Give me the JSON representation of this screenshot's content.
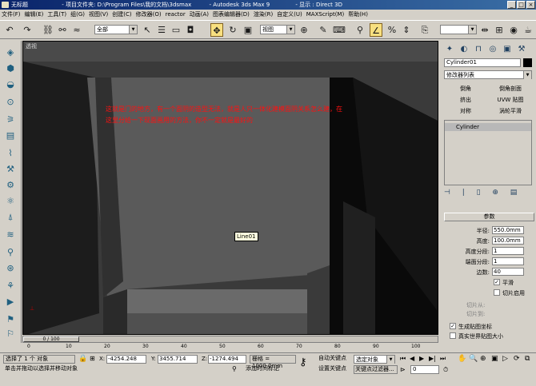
{
  "title": {
    "app": "无标题",
    "project": "- 项目文件夹: D:\\Program Files\\我的文档\\3dsmax",
    "product": "- Autodesk 3ds Max 9",
    "display": "- 显示 : Direct 3D"
  },
  "menu": [
    "文件(F)",
    "编辑(E)",
    "工具(T)",
    "组(G)",
    "视图(V)",
    "创建(C)",
    "修改器(O)",
    "reactor",
    "动画(A)",
    "图表编辑器(D)",
    "渲染(R)",
    "自定义(U)",
    "MAXScript(M)",
    "帮助(H)"
  ],
  "toolbar": {
    "filter": "全部",
    "refcoord": "视图"
  },
  "viewport": {
    "label": "透视",
    "annotation": "这就是门的地方，有一个面阴的造型无法，就是人只一体化建模面阴关系怎么建，在这里分给一下现面画用的方法，你不一定就是最好的",
    "tooltip": "Line01"
  },
  "panel": {
    "object_name": "Cylinder01",
    "modifier_list": "修改器列表",
    "buttons": [
      "倒角",
      "倒角剖面",
      "挤出",
      "UVW 贴图",
      "对称",
      "涡轮平滑"
    ],
    "stack_item": "Cylinder",
    "params_title": "参数",
    "params": [
      {
        "label": "半径:",
        "value": "550.0mm"
      },
      {
        "label": "高度:",
        "value": "100.0mm"
      },
      {
        "label": "高度分段:",
        "value": "1"
      },
      {
        "label": "端面分段:",
        "value": "1"
      },
      {
        "label": "边数:",
        "value": "40"
      }
    ],
    "smooth": "平滑",
    "slice_on": "切片启用",
    "slice_from": "切片从:",
    "slice_to": "切片到:",
    "gen_map": "生成贴图坐标",
    "real_world": "真实世界贴图大小"
  },
  "timeline": {
    "frame": "0 / 100",
    "ticks": [
      "0",
      "10",
      "20",
      "30",
      "40",
      "50",
      "60",
      "70",
      "80",
      "90",
      "100"
    ]
  },
  "status": {
    "selected": "选择了 1 个 对象",
    "hint": "单击并拖动以选择并移动对象",
    "x": "-4254.248",
    "y": "3455.714",
    "z": "-1274.494",
    "grid": "栅格 = 1000.0mm",
    "autokey": "自动关键点",
    "setkey": "设置关键点",
    "selset": "选定对象",
    "keyfilter": "关键点过滤器...",
    "addtime": "添加时间标记",
    "frame": "0"
  }
}
